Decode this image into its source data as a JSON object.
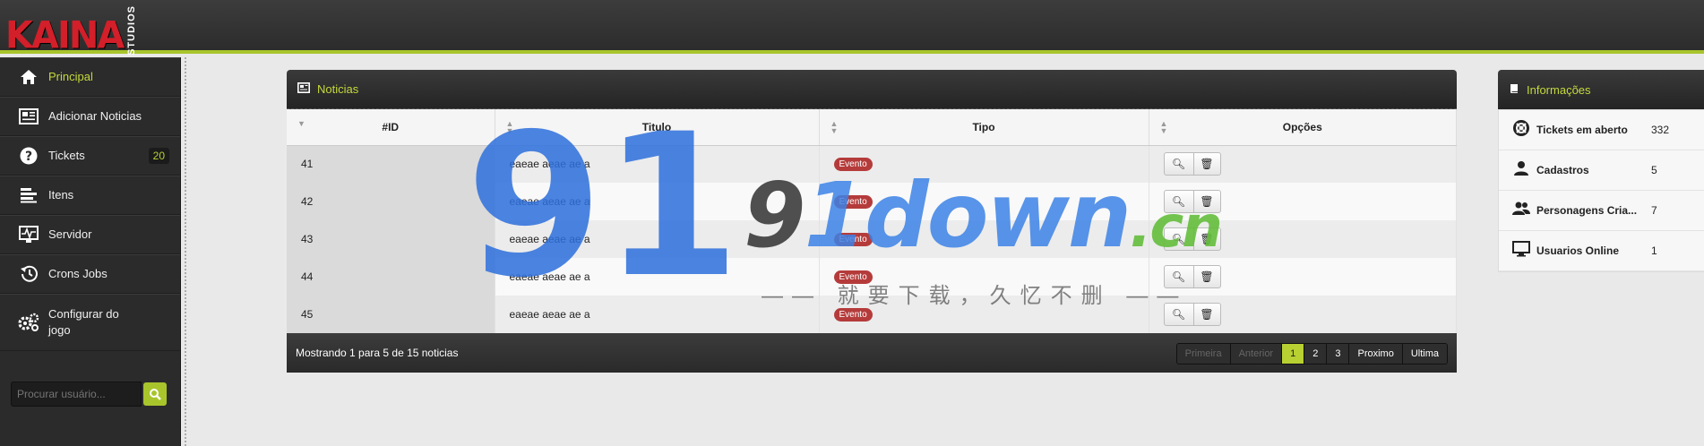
{
  "brand": {
    "name": "KAINA",
    "sub": "STUDIOS",
    "accent": "#a8c52b",
    "logo_red": "#d21f2a"
  },
  "sidebar": {
    "items": [
      {
        "label": "Principal",
        "icon": "home-icon",
        "active": true
      },
      {
        "label": "Adicionar Noticias",
        "icon": "newspaper-icon"
      },
      {
        "label": "Tickets",
        "icon": "question-icon",
        "badge": "20"
      },
      {
        "label": "Itens",
        "icon": "list-icon"
      },
      {
        "label": "Servidor",
        "icon": "monitor-pulse-icon"
      },
      {
        "label": "Crons Jobs",
        "icon": "history-icon"
      },
      {
        "label": "Configurar do jogo",
        "icon": "gears-icon"
      }
    ],
    "search": {
      "placeholder": "Procurar usuário...",
      "icon": "search-icon"
    }
  },
  "news": {
    "title": "Noticias",
    "columns": [
      "#ID",
      "Titulo",
      "Tipo",
      "Opções"
    ],
    "rows": [
      {
        "id": "41",
        "title": "eaeae aeae ae a",
        "type": "Evento"
      },
      {
        "id": "42",
        "title": "eaeae aeae ae a",
        "type": "Evento"
      },
      {
        "id": "43",
        "title": "eaeae aeae ae a",
        "type": "Evento"
      },
      {
        "id": "44",
        "title": "eaeae aeae ae a",
        "type": "Evento"
      },
      {
        "id": "45",
        "title": "eaeae aeae ae a",
        "type": "Evento"
      }
    ],
    "footer_text": "Mostrando 1 para 5 de 15 noticias",
    "pager": {
      "first": "Primeira",
      "prev": "Anterior",
      "pages": [
        "1",
        "2",
        "3"
      ],
      "next": "Proximo",
      "last": "Ultima",
      "current": "1"
    }
  },
  "info": {
    "title": "Informações",
    "rows": [
      {
        "label": "Tickets em aberto",
        "value": "332",
        "icon": "lifebuoy-icon"
      },
      {
        "label": "Cadastros",
        "value": "5",
        "icon": "user-icon"
      },
      {
        "label": "Personagens Cria...",
        "value": "7",
        "icon": "users-icon"
      },
      {
        "label": "Usuarios Online",
        "value": "1",
        "icon": "monitor-icon"
      }
    ]
  },
  "watermark": {
    "digits": "91",
    "site_a": "9",
    "site_b": "1down",
    "tld": ".cn",
    "tagline": "—— 就要下载，久忆不删 ——"
  }
}
